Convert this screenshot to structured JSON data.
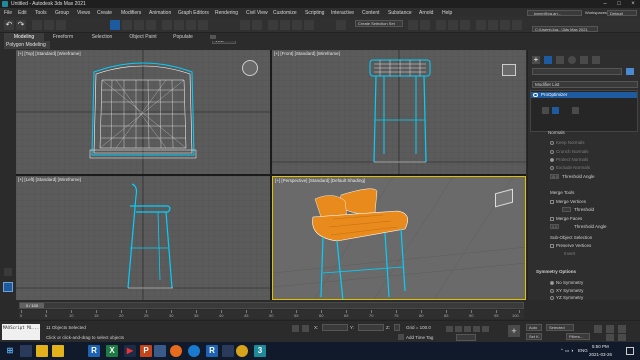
{
  "window": {
    "title": "Untitled - Autodesk 3ds Max 2021"
  },
  "menu": [
    "File",
    "Edit",
    "Tools",
    "Group",
    "Views",
    "Create",
    "Modifiers",
    "Animation",
    "Graph Editors",
    "Rendering",
    "Civil View",
    "Customize",
    "Scripting",
    "Interactive",
    "Content",
    "Substance",
    "Arnold",
    "Help"
  ],
  "account": {
    "user": "kyner@va.ari...",
    "workspace_label": "Workspaces:",
    "workspace_value": "Default"
  },
  "toolbar": {
    "view_mode": "View",
    "selection_set": "Create Selection Set",
    "project_path": "C:\\Users\\Jua...\\3ds Max 2021"
  },
  "ribbon": {
    "tabs": [
      "Modeling",
      "Freeform",
      "Selection",
      "Object Paint",
      "Populate"
    ],
    "active_label": "Polygon Modeling"
  },
  "viewports": [
    {
      "label": "[+] [Top] [Standard] [Wireframe]"
    },
    {
      "label": "[+] [Front] [Standard] [Wireframe]"
    },
    {
      "label": "[+] [Left] [Standard] [Wireframe]"
    },
    {
      "label": "[+] [Perspective] [Standard] [Default Shading]"
    }
  ],
  "command_panel": {
    "modifier_list": "Modifier List",
    "stack_item": "ProOptimizer",
    "normals_header": "Normals",
    "normals_options": [
      "Keep Normals",
      "Crunch Normals",
      "Protect Normals",
      "Exclude Normals"
    ],
    "threshold_angle_label": "Threshold Angle",
    "threshold_angle_value": "15.0",
    "merge_tools_header": "Merge Tools",
    "merge_vertices_label": "Merge Vertices",
    "merge_vertices_threshold_label": "Threshold",
    "merge_faces_label": "Merge Faces",
    "merge_faces_value": "0.0",
    "merge_faces_threshold_label": "Threshold Angle",
    "subobject_header": "Sub-Object Selection",
    "preserve_vertices": "Preserve Vertices",
    "invert": "Invert",
    "symmetry_header": "Symmetry Options",
    "symmetry_options": [
      "No Symmetry",
      "XY Symmetry",
      "YZ Symmetry"
    ]
  },
  "timeline": {
    "slider": "0 / 100",
    "ticks": [
      "0",
      "5",
      "10",
      "15",
      "20",
      "25",
      "30",
      "35",
      "40",
      "45",
      "50",
      "55",
      "60",
      "65",
      "70",
      "75",
      "80",
      "85",
      "90",
      "95",
      "100"
    ]
  },
  "status": {
    "script_label": "MAXScript Mi...",
    "selected": "11 Objects Selected",
    "prompt": "Click or click-and-drag to select objects",
    "x": "X:",
    "y": "Y:",
    "z": "Z:",
    "grid": "Grid = 100.0",
    "add_time_tag": "Add Time Tag",
    "auto": "Auto",
    "selected_dropdown": "Selected",
    "setk": "Set K.",
    "filters": "Filters..."
  },
  "taskbar": {
    "time": "5:50 PM",
    "date": "2021-03-26",
    "lang": "ENG"
  },
  "colors": {
    "accent": "#1e5aa0",
    "chair_seat": "#e88a1c",
    "wire": "#ffffff",
    "selection": "#00d0ff"
  }
}
